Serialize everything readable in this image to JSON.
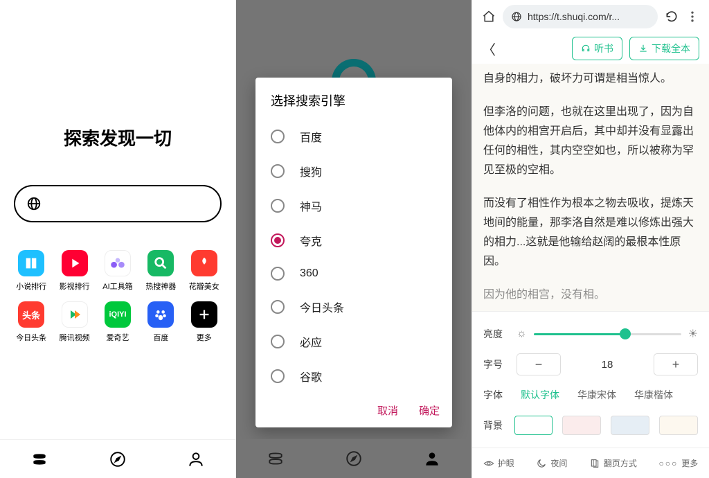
{
  "panel1": {
    "title": "探索发现一切",
    "search_placeholder": "",
    "apps": [
      {
        "label": "小说排行",
        "color": "#1ec0ff",
        "icon": "book"
      },
      {
        "label": "影视排行",
        "color": "#ff0033",
        "icon": "play"
      },
      {
        "label": "AI工具箱",
        "color": "#fff",
        "icon": "ai"
      },
      {
        "label": "热搜神器",
        "color": "#17b964",
        "icon": "search"
      },
      {
        "label": "花瓣美女",
        "color": "#ff3b30",
        "icon": "petal"
      },
      {
        "label": "今日头条",
        "color": "#ff3b30",
        "icon": "toutiao"
      },
      {
        "label": "腾讯视频",
        "color": "#ffffff",
        "icon": "tencent"
      },
      {
        "label": "爱奇艺",
        "color": "#00c83c",
        "icon": "iqiyi"
      },
      {
        "label": "百度",
        "color": "#2760f5",
        "icon": "baidu"
      },
      {
        "label": "更多",
        "color": "#000000",
        "icon": "plus"
      }
    ],
    "nav": [
      "home",
      "compass",
      "person"
    ]
  },
  "panel2": {
    "dialog_title": "选择搜索引擎",
    "options": [
      "百度",
      "搜狗",
      "神马",
      "夸克",
      "360",
      "今日头条",
      "必应",
      "谷歌"
    ],
    "selected_index": 3,
    "cancel": "取消",
    "confirm": "确定"
  },
  "panel3": {
    "url": "https://t.shuqi.com/r...",
    "listen": "听书",
    "download": "下载全本",
    "paragraphs": [
      "自身的相力，破坏力可谓是相当惊人。",
      "但李洛的问题，也就在这里出现了，因为自他体内的相宫开启后，其中却并没有显露出任何的相性，其内空空如也，所以被称为罕见至极的空相。",
      "而没有了相性作为根本之物去吸收，提炼天地间的能量，那李洛自然是难以修炼出强大的相力...这就是他输给赵阔的最根本性原因。",
      "因为他的相宫，没有相。"
    ],
    "settings": {
      "brightness_label": "亮度",
      "fontsize_label": "字号",
      "fontsize_value": "18",
      "font_label": "字体",
      "font_options": [
        "默认字体",
        "华康宋体",
        "华康楷体"
      ],
      "font_selected": 0,
      "bg_label": "背景"
    },
    "bottom": {
      "eyecare": "护眼",
      "night": "夜间",
      "flip": "翻页方式",
      "more": "更多"
    }
  }
}
